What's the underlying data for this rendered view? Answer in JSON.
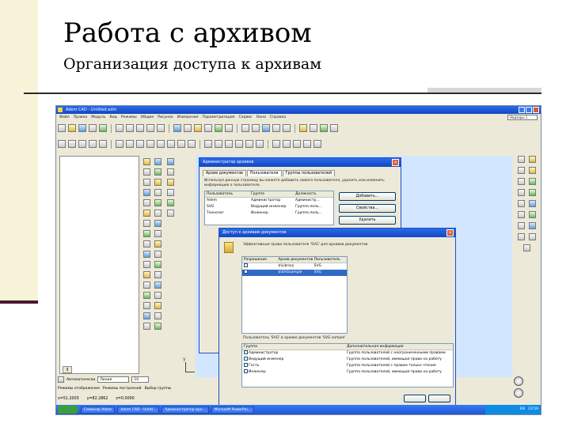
{
  "slide": {
    "title": "Работа с архивом",
    "subtitle": "Организация доступа к архивам"
  },
  "app": {
    "title": "Adem CAD - Untitled.adm",
    "menu": [
      "Файл",
      "Правка",
      "Модуль",
      "Вид",
      "Режимы",
      "Общие",
      "Рисунок",
      "Измерения",
      "Параметризация",
      "Сервис",
      "Окно",
      "Справка"
    ],
    "doc_field": "Надзоры 1",
    "panel_tab": "3",
    "bottom_bar": {
      "line_label": "Линия",
      "line_value": "10"
    },
    "modes": {
      "auto": "Автоматически",
      "mode_a": "Режимы отображения",
      "mode_b": "Режимы построений",
      "mode_c": "Выбор группы"
    },
    "coords": {
      "x": "x=51.2003",
      "y": "y=82.2862",
      "z": "z=0.0000"
    },
    "axis_label": "Y",
    "taskbar": {
      "tasks": [
        "Семинар Adem",
        "Adem CAD - Untitl...",
        "Администратор арх...",
        "Microsoft PowerPoi..."
      ],
      "tray_lang": "EN",
      "tray_time": "23:59"
    }
  },
  "dialog_admin": {
    "title": "Администратор архивов",
    "tabs": [
      "Архив документов",
      "Пользователи",
      "Группы пользователей"
    ],
    "description": "Используя данную страницу вы можете добавить нового пользователя, удалить или изменить информацию о пользователе.",
    "columns": [
      "Пользователь",
      "Группа",
      "Должность"
    ],
    "rows": [
      [
        "Adem",
        "Администратор",
        "Администр..."
      ],
      [
        "SVG",
        "Ведущий инженер",
        "Группа поль..."
      ],
      [
        "Технолог",
        "Инженер",
        "Группа поль..."
      ]
    ],
    "buttons": [
      "Добавить...",
      "Свойства...",
      "Удалить"
    ]
  },
  "dialog_access": {
    "title": "Доступ к архивам документов",
    "caption": "Эффективные права пользователя 'SVG' для архивов документов",
    "columns": [
      "Разрешение",
      "Архив документов",
      "Пользователь"
    ],
    "rows": [
      {
        "perm": "",
        "archive": "$\\Library",
        "user": "SVG"
      },
      {
        "perm": "",
        "archive": "$\\SVGsample",
        "user": "SVG"
      }
    ],
    "groups_caption": "Пользователь 'SVG' в архиве документов 'SVG sample'",
    "group_columns": [
      "Группа",
      "Дополнительная информация"
    ],
    "group_rows": [
      [
        "Администратор",
        "Группа пользователей с неограниченными правами"
      ],
      [
        "Ведущий инженер",
        "Группа пользователей, имеющая права на работу"
      ],
      [
        "Гость",
        "Группа пользователей с правом только чтения"
      ],
      [
        "Инженер",
        "Группа пользователей, имеющая права на работу"
      ]
    ]
  },
  "colors": {
    "slide_accent": "#4b1632",
    "selection": "#316ac5",
    "titlebar": "#1147c4"
  }
}
